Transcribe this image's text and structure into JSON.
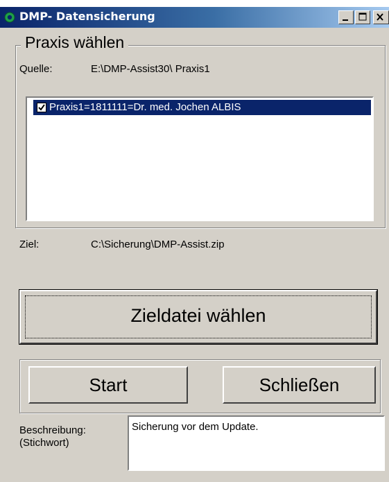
{
  "window": {
    "title": "DMP- Datensicherung"
  },
  "praxis_group": {
    "title": "Praxis wählen",
    "source_label": "Quelle:",
    "source_value": "E:\\DMP-Assist30\\ Praxis1",
    "list_items": [
      {
        "label": "Praxis1=1811111=Dr. med. Jochen ALBIS",
        "checked": true,
        "selected": true
      }
    ]
  },
  "target": {
    "label": "Ziel:",
    "value": "C:\\Sicherung\\DMP-Assist.zip"
  },
  "buttons": {
    "choose_target": "Zieldatei wählen",
    "start": "Start",
    "close": "Schließen"
  },
  "description": {
    "label_line1": "Beschreibung:",
    "label_line2": "(Stichwort)",
    "value": "Sicherung vor dem Update."
  },
  "colors": {
    "titlebar_start": "#0a246a",
    "selection": "#0a246a",
    "face": "#d4d0c8"
  },
  "icons": {
    "app": "gear-icon",
    "minimize": "minimize-icon",
    "maximize": "maximize-icon",
    "close": "close-icon"
  }
}
